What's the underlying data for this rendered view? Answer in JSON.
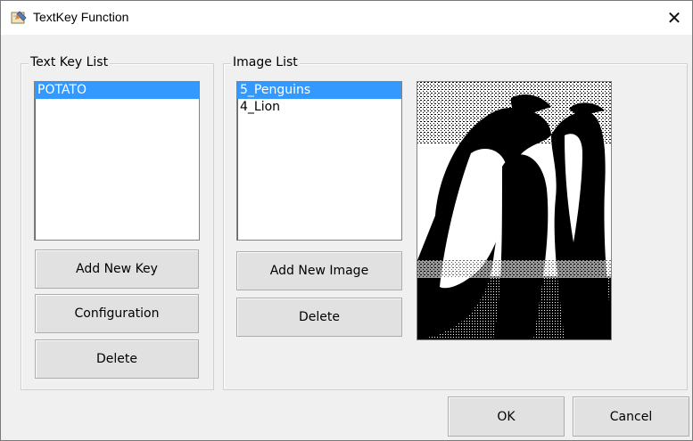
{
  "window": {
    "title": "TextKey Function",
    "close_glyph": "✕"
  },
  "text_key_group": {
    "legend": "Text Key List",
    "items": [
      "POTATO"
    ],
    "selected_index": 0,
    "buttons": {
      "add": "Add New Key",
      "config": "Configuration",
      "delete": "Delete"
    }
  },
  "image_group": {
    "legend": "Image List",
    "items": [
      "5_Penguins",
      "4_Lion"
    ],
    "selected_index": 0,
    "buttons": {
      "add": "Add New Image",
      "delete": "Delete"
    },
    "preview_icon": "penguins-image"
  },
  "footer": {
    "ok": "OK",
    "cancel": "Cancel"
  },
  "colors": {
    "selection": "#3399ff",
    "dialog_bg": "#f0f0f0"
  }
}
